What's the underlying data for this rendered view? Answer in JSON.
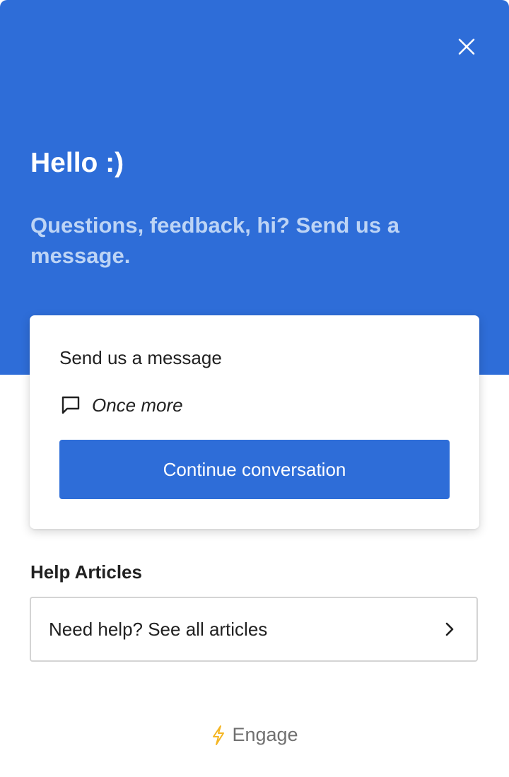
{
  "colors": {
    "brand_blue": "#2e6dd8",
    "intro_text": "#bdd4f5",
    "text_dark": "#212121",
    "muted": "#707070",
    "bolt": "#f5b623"
  },
  "header": {
    "close_icon": "close-icon",
    "greeting": "Hello :)",
    "intro": "Questions, feedback, hi? Send us a message."
  },
  "message_card": {
    "title": "Send us a message",
    "last_conversation_icon": "chat-bubble-icon",
    "last_conversation": "Once more",
    "continue_label": "Continue conversation"
  },
  "help": {
    "title": "Help Articles",
    "all_articles_label": "Need help? See all articles",
    "chevron_icon": "chevron-right-icon"
  },
  "footer": {
    "bolt_icon": "lightning-bolt-icon",
    "brand": "Engage"
  }
}
